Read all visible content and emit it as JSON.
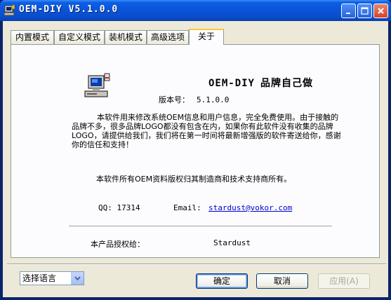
{
  "window": {
    "title": "OEM-DIY V5.1.0.0"
  },
  "tabs": [
    {
      "label": "内置模式"
    },
    {
      "label": "自定义模式"
    },
    {
      "label": "装机模式"
    },
    {
      "label": "高级选项"
    },
    {
      "label": "关于",
      "active": true
    }
  ],
  "about": {
    "product_name": "OEM-DIY",
    "slogan": "品牌自己做",
    "version_label": "版本号：",
    "version_value": "5.1.0.0",
    "description": "本软件用来修改系统OEM信息和用户信息，完全免费使用。由于接触的品牌不多，很多品牌LOGO都没有包含在内，如果你有此软件没有收集的品牌LOGO，请提供给我们，我们将在第一时间将最新增强版的软件寄送给你，感谢你的信任和支持！",
    "copyright": "本软件所有OEM资料版权归其制造商和技术支持商所有。",
    "qq_label": "QQ:",
    "qq_value": "17314",
    "email_label": "Email:",
    "email_value": "stardust@vokor.com",
    "license_label": "本产品授权给：",
    "license_value": "Stardust"
  },
  "footer": {
    "language_select": "选择语言",
    "ok_label": "确定",
    "cancel_label": "取消",
    "apply_label": "应用(A)"
  },
  "colors": {
    "titlebar": "#0a54d8",
    "dialog_bg": "#ece9d8",
    "panel_bg": "#fcfcfe",
    "link": "#0000cc",
    "tab_highlight": "#ffc83c"
  },
  "icons": [
    "app-icon",
    "computer-icon",
    "minimize-icon",
    "maximize-icon",
    "close-icon",
    "chevron-down-icon"
  ]
}
